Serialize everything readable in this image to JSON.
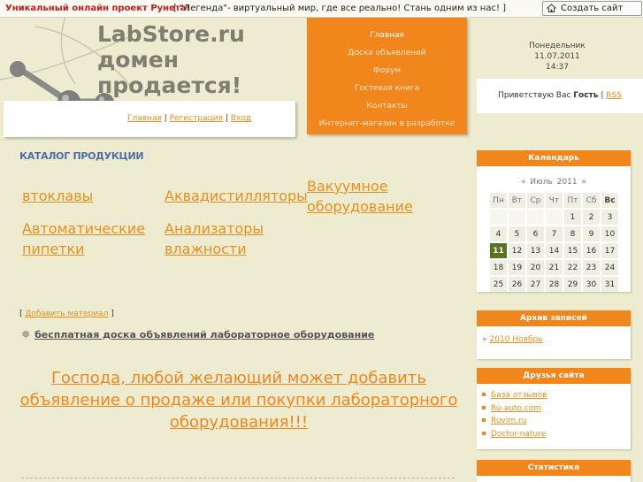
{
  "topbar": {
    "promo": "Уникальный онлайн проект Рунета!",
    "legend": "[ \"Легенда\"- виртуальный мир, где все реально! Стань одним из нас! ]",
    "create_site": "Создать сайт"
  },
  "header": {
    "title": "LabStore.ru\nдомен\nпродается!",
    "login_links": [
      "Главная",
      "Регистрация",
      "Вход"
    ]
  },
  "nav": {
    "items": [
      "Главная",
      "Доска объявлений",
      "Форум",
      "Гостевая книга",
      "Контакты",
      "Интернет-магазин в разработке"
    ]
  },
  "date": {
    "weekday": "Понедельник",
    "date": "11.07.2011",
    "time": "14:37"
  },
  "greeting": {
    "prefix": "Приветствую Вас",
    "user": "Гость",
    "rss": "RSS"
  },
  "catalog": {
    "heading": "КАТАЛОГ ПРОДУКЦИИ",
    "items": [
      "втоклавы",
      "Аквадистилляторы",
      "Вакуумное оборудование",
      "Автоматические пипетки",
      "Анализаторы влажности"
    ]
  },
  "add_material": "Добавить материал",
  "ad_link": "бесплатная доска объявлений лабораторное оборудование",
  "announcement": "Господа, любой желающий может добавить объявление о продаже или покупки лабораторного оборудования!!!",
  "calendar": {
    "title": "Календарь",
    "prev": "«",
    "month": "Июль 2011",
    "next": "»",
    "weekdays": [
      "Пн",
      "Вт",
      "Ср",
      "Чт",
      "Пт",
      "Сб",
      "Вс"
    ],
    "weeks": [
      [
        "",
        "",
        "",
        "",
        "1",
        "2",
        "3"
      ],
      [
        "4",
        "5",
        "6",
        "7",
        "8",
        "9",
        "10"
      ],
      [
        "11",
        "12",
        "13",
        "14",
        "15",
        "16",
        "17"
      ],
      [
        "18",
        "19",
        "20",
        "21",
        "22",
        "23",
        "24"
      ],
      [
        "25",
        "26",
        "27",
        "28",
        "29",
        "30",
        "31"
      ]
    ],
    "today": "11"
  },
  "archive": {
    "title": "Архив записей",
    "items": [
      "2010 Ноябрь"
    ]
  },
  "friends": {
    "title": "Друзья сайта",
    "items": [
      "База отзывов",
      "Ru-auto.com",
      "Ruvim.ru",
      "Doctor-nature"
    ]
  },
  "stats": {
    "title": "Статистика"
  },
  "colors": {
    "accent": "#f0861c",
    "link": "#e8901e",
    "background": "#eeecd0",
    "today": "#56741e"
  }
}
